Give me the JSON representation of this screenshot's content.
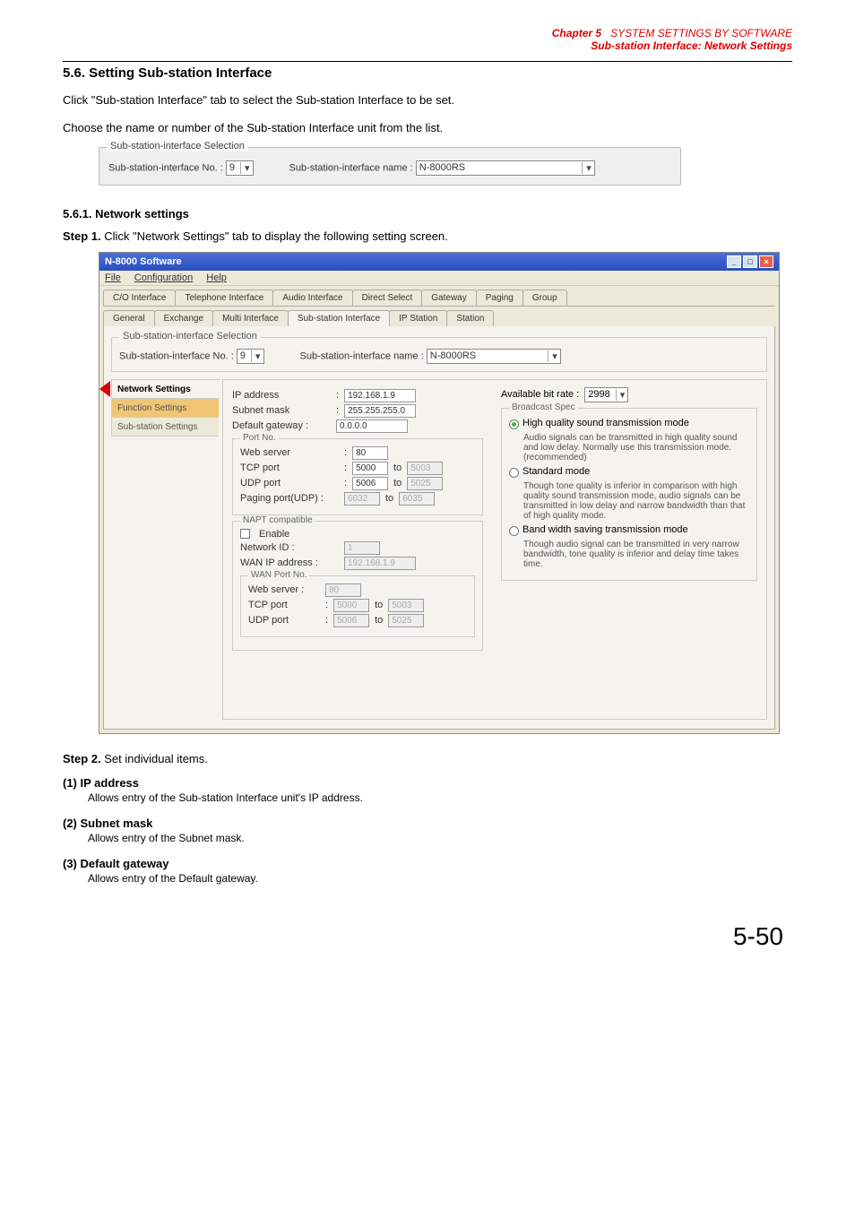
{
  "header": {
    "chapter": "Chapter 5",
    "line1": "SYSTEM SETTINGS BY SOFTWARE",
    "line2": "Sub-station Interface: Network Settings"
  },
  "section": {
    "title": "5.6. Setting Sub-station Interface",
    "p1": "Click \"Sub-station Interface\" tab to select the Sub-station Interface to be set.",
    "p2": "Choose the name or number of the Sub-station Interface unit from the list."
  },
  "fieldset1": {
    "legend": "Sub-station-interface Selection",
    "noLabel": "Sub-station-interface  No. :",
    "noValue": "9",
    "nameLabel": "Sub-station-interface  name :",
    "nameValue": "N-8000RS"
  },
  "sub1": {
    "heading": "5.6.1. Network settings",
    "step1": "Step 1.",
    "step1text": " Click \"Network Settings\" tab to display the following setting screen."
  },
  "win": {
    "title": "N-8000 Software",
    "menu": {
      "file": "File",
      "config": "Configuration",
      "help": "Help"
    },
    "tabs_row1": [
      "C/O Interface",
      "Telephone Interface",
      "Audio Interface",
      "Direct Select",
      "Gateway",
      "Paging",
      "Group"
    ],
    "tabs_row2": [
      "General",
      "Exchange",
      "Multi Interface",
      "Sub-station Interface",
      "IP Station",
      "Station"
    ],
    "innersel": {
      "legend": "Sub-station-interface Selection",
      "noLabel": "Sub-station-interface  No. :",
      "noValue": "9",
      "nameLabel": "Sub-station-interface  name :",
      "nameValue": "N-8000RS"
    },
    "sidetabs": {
      "net": "Network Settings",
      "fn": "Function Settings",
      "sub": "Sub-station Settings"
    },
    "form": {
      "ip_lbl": "IP address",
      "ip_val": "192.168.1.9",
      "mask_lbl": "Subnet mask",
      "mask_val": "255.255.255.0",
      "gw_lbl": "Default gateway :",
      "gw_val": "0.0.0.0",
      "port_legend": "Port No.",
      "web_lbl": "Web server",
      "web_val": "80",
      "tcp_lbl": "TCP port",
      "tcp_from": "5000",
      "to": "to",
      "tcp_to": "5003",
      "udp_lbl": "UDP port",
      "udp_from": "5006",
      "udp_to": "5025",
      "pg_lbl": "Paging port(UDP) :",
      "pg_from": "6032",
      "pg_to": "6035",
      "napt_legend": "NAPT compatible",
      "enable": "Enable",
      "netid_lbl": "Network ID :",
      "netid_val": "1",
      "wanip_lbl": "WAN IP address :",
      "wanip_val": "192.168.1.9",
      "wanport_legend": "WAN Port No.",
      "w_web_lbl": "Web server :",
      "w_web_val": "80",
      "w_tcp_lbl": "TCP port",
      "w_tcp_from": "5000",
      "w_tcp_to": "5003",
      "w_udp_lbl": "UDP port",
      "w_udp_from": "5006",
      "w_udp_to": "5025"
    },
    "right": {
      "avail_lbl": "Available bit rate :",
      "avail_val": "2998",
      "bc_legend": "Broadcast Spec",
      "r1_label": "High quality sound transmission mode",
      "r1_desc": "Audio signals can be transmitted in high quality sound and low delay. Normally use this transmission mode.(recommended)",
      "r2_label": "Standard mode",
      "r2_desc": "Though tone quality is inferior in comparison with high quality sound transmission mode, audio signals can be transmitted in low delay and narrow bandwidth than that of high quality mode.",
      "r3_label": "Band width saving transmission mode",
      "r3_desc": "Though audio signal can be transmitted in very narrow bandwidth, tone quality is inferior and delay time takes time."
    }
  },
  "step2": {
    "label": "Step 2.",
    "text": " Set individual items."
  },
  "items": {
    "i1h": "(1)  IP address",
    "i1d": "Allows entry of the Sub-station Interface unit's IP address.",
    "i2h": "(2)  Subnet mask",
    "i2d": "Allows entry of the Subnet mask.",
    "i3h": "(3)  Default gateway",
    "i3d": "Allows entry of the Default gateway."
  },
  "pagenum": "5-50"
}
